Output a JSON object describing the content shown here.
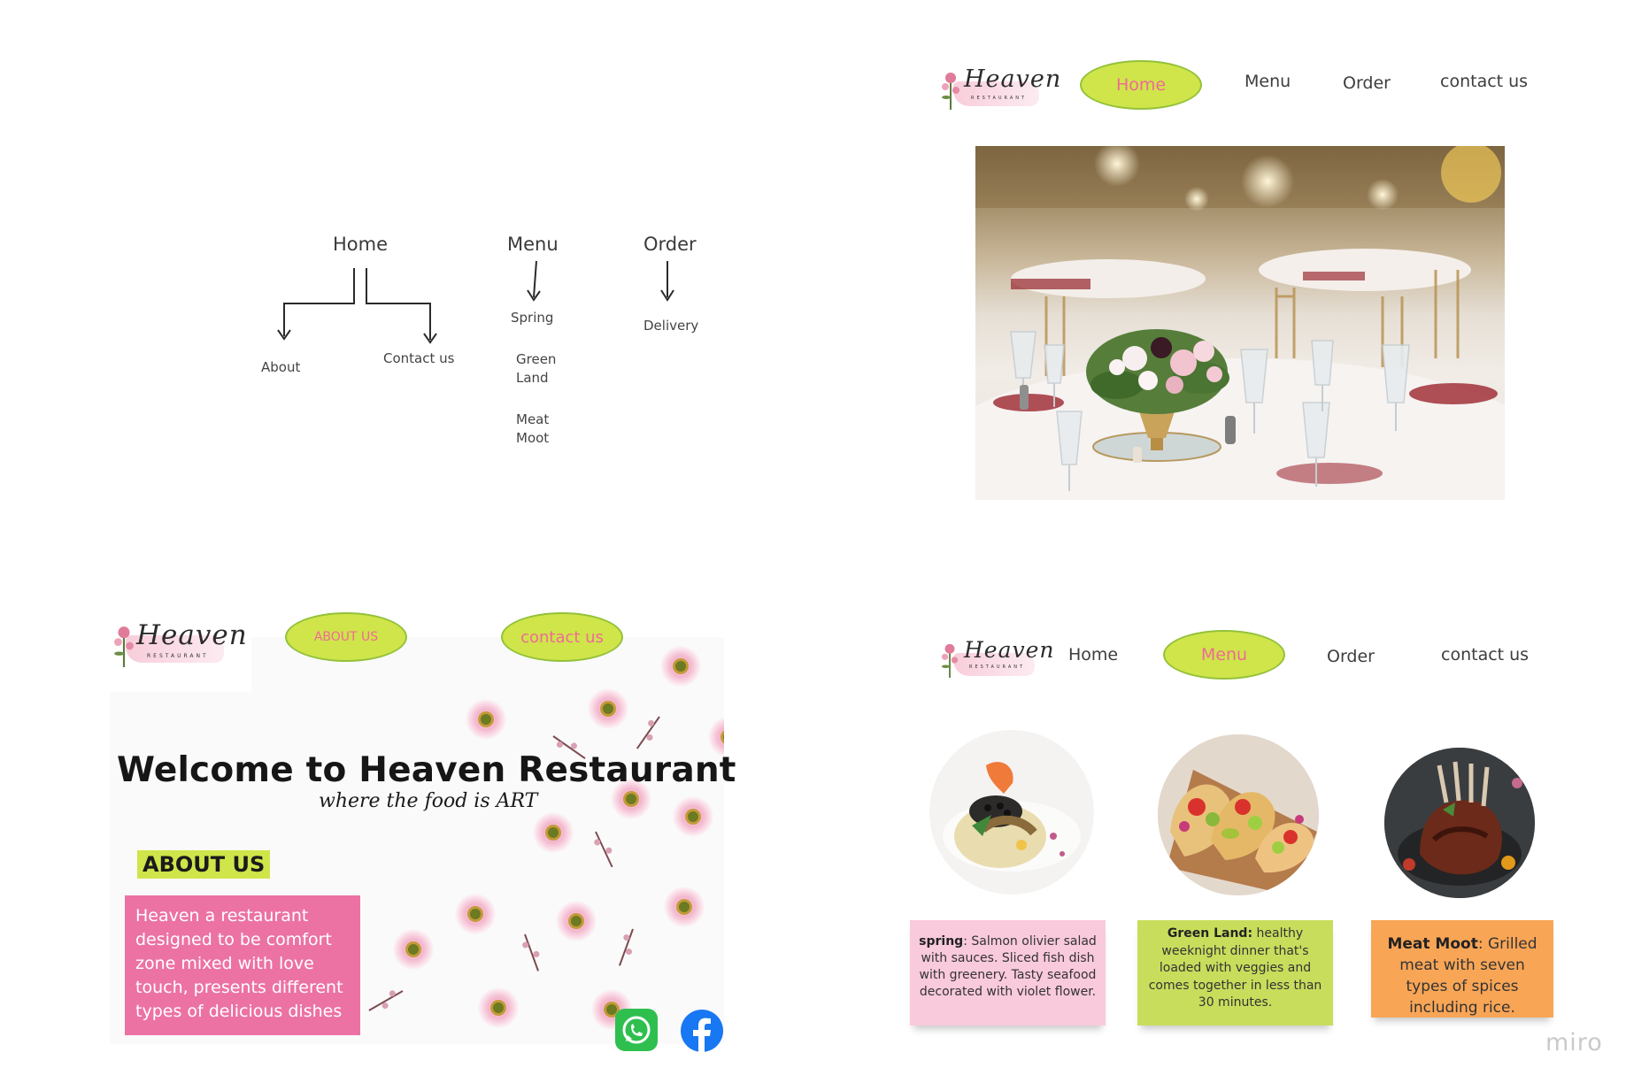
{
  "sitemap": {
    "home": {
      "label": "Home",
      "children": [
        "About",
        "Contact us"
      ]
    },
    "menu": {
      "label": "Menu",
      "children": [
        "Spring",
        "Green Land",
        "Meat Moot"
      ]
    },
    "order": {
      "label": "Order",
      "children": [
        "Delivery"
      ]
    }
  },
  "logo": {
    "script": "Heaven",
    "sub": "RESTAURANT"
  },
  "home_frame": {
    "nav": {
      "home": "Home",
      "menu": "Menu",
      "order": "Order",
      "contact": "contact us"
    },
    "active": "Home"
  },
  "about_frame": {
    "about_button": "ABOUT US",
    "contact_button": "contact us",
    "welcome": "Welcome to Heaven Restaurant",
    "tagline": "where the food is ART",
    "about_heading": "ABOUT US",
    "about_text": "Heaven a restaurant designed to be comfort zone mixed with love touch, presents different types of delicious dishes",
    "social": [
      "whatsapp-icon",
      "facebook-icon"
    ]
  },
  "menu_frame": {
    "nav": {
      "home": "Home",
      "menu": "Menu",
      "order": "Order",
      "contact": "contact us"
    },
    "active": "Menu",
    "cards": [
      {
        "name": "spring",
        "desc": ": Salmon olivier salad with sauces. Sliced fish dish with greenery. Tasty seafood decorated with violet flower.",
        "color": "#f9c9dc"
      },
      {
        "name": "Green Land:",
        "desc": " healthy weeknight dinner that's loaded with veggies and comes together in less than 30 minutes.",
        "color": "#c8dd5c"
      },
      {
        "name": "Meat Moot",
        "desc": ": Grilled meat with seven types of spices including rice.",
        "color": "#f8a556"
      }
    ]
  },
  "watermark": "miro",
  "colors": {
    "pill": "#cfe54a",
    "pill_text": "#f06a97",
    "about_box": "#ec72a4"
  }
}
